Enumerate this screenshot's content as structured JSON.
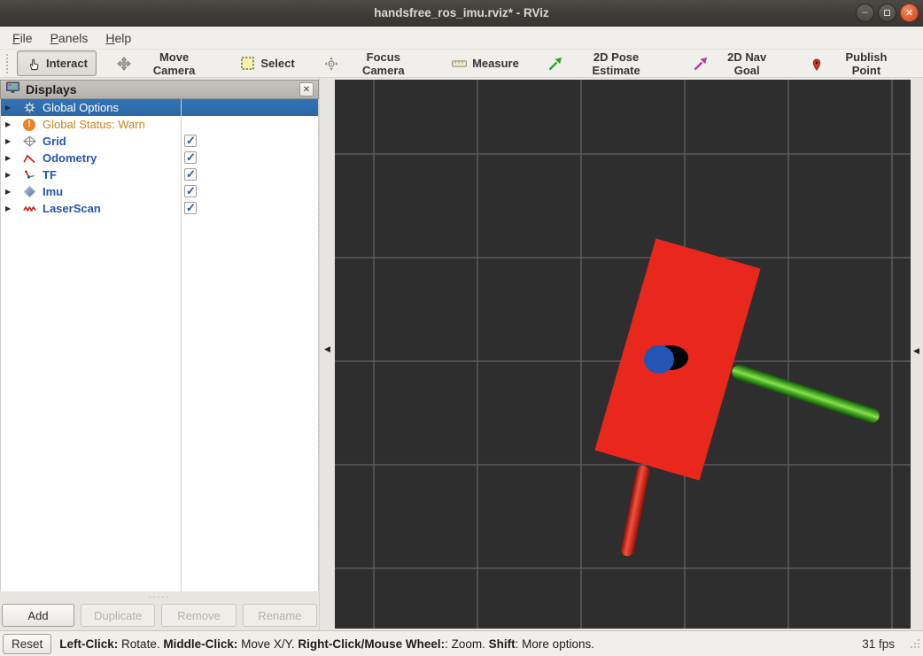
{
  "window": {
    "title": "handsfree_ros_imu.rviz* - RViz",
    "buttons": [
      "minimize",
      "maximize",
      "close"
    ]
  },
  "menu": {
    "items": [
      "File",
      "Panels",
      "Help"
    ]
  },
  "toolbar": {
    "tools": [
      {
        "label": "Interact",
        "icon": "hand-icon",
        "active": true
      },
      {
        "label": "Move Camera",
        "icon": "move-arrows-icon",
        "active": false
      },
      {
        "label": "Select",
        "icon": "selection-box-icon",
        "active": false
      },
      {
        "label": "Focus Camera",
        "icon": "focus-crosshair-icon",
        "active": false
      },
      {
        "label": "Measure",
        "icon": "ruler-icon",
        "active": false
      },
      {
        "label": "2D Pose Estimate",
        "icon": "pose-arrow-icon",
        "active": false
      },
      {
        "label": "2D Nav Goal",
        "icon": "nav-goal-arrow-icon",
        "active": false
      },
      {
        "label": "Publish Point",
        "icon": "map-pin-icon",
        "active": false
      }
    ]
  },
  "displays": {
    "title": "Displays",
    "rows": [
      {
        "label": "Global Options",
        "icon": "gear-icon",
        "selected": true
      },
      {
        "label": "Global Status: Warn",
        "icon": "warning-icon",
        "status": "warn"
      },
      {
        "label": "Grid",
        "icon": "grid-icon",
        "checked": true
      },
      {
        "label": "Odometry",
        "icon": "odometry-icon",
        "checked": true
      },
      {
        "label": "TF",
        "icon": "tf-axes-icon",
        "checked": true
      },
      {
        "label": "Imu",
        "icon": "imu-icon",
        "checked": true
      },
      {
        "label": "LaserScan",
        "icon": "laserscan-icon",
        "checked": true
      }
    ],
    "buttons": [
      {
        "label": "Add",
        "enabled": true
      },
      {
        "label": "Duplicate",
        "enabled": false
      },
      {
        "label": "Remove",
        "enabled": false
      },
      {
        "label": "Rename",
        "enabled": false
      }
    ]
  },
  "statusbar": {
    "reset_label": "Reset",
    "segments": [
      "Left-Click:",
      " Rotate. ",
      "Middle-Click:",
      " Move X/Y. ",
      "Right-Click/Mouse Wheel:",
      ": Zoom. ",
      "Shift",
      ": More options."
    ],
    "fps": "31 fps"
  },
  "colors": {
    "titlebar": "#3c3b37",
    "selected_row": "#3173b5",
    "warn_text": "#c9851a",
    "display_name": "#2456b0",
    "viewport_bg": "#2e2e2e",
    "grid_line": "#5c5c5c",
    "imu_red": "#e9271d",
    "rod_green": "#57c232",
    "disc_blue": "#2355b4",
    "close_button": "#e0592e"
  }
}
